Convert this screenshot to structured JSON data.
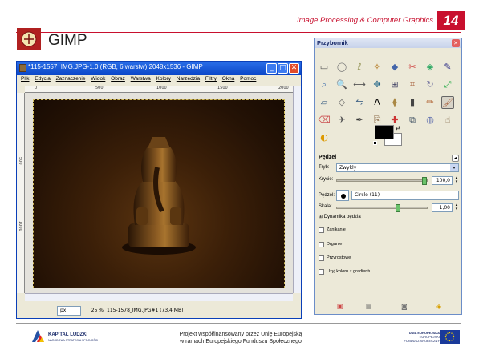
{
  "slide": {
    "header_title": "Image Processing & Computer Graphics",
    "page_number": "14",
    "heading": "GIMP"
  },
  "image_window": {
    "title": "*115-1557_IMG.JPG-1.0 (RGB, 6 warstw) 2048x1536 - GIMP",
    "menu": [
      "Plik",
      "Edycja",
      "Zaznaczenie",
      "Widok",
      "Obraz",
      "Warstwa",
      "Kolory",
      "Narzędzia",
      "Filtry",
      "Okna",
      "Pomoc"
    ],
    "ruler_h_ticks": [
      "0",
      "500",
      "1000",
      "1500",
      "2000"
    ],
    "ruler_v_ticks": [
      "500",
      "1000"
    ],
    "unit": "px",
    "zoom": "25 %",
    "status": "115-1578_IMG.JPG#1 (73,4 MB)"
  },
  "toolbox": {
    "title": "Przybornik",
    "options_title": "Pędzel",
    "mode_label": "Tryb:",
    "mode_value": "Zwykły",
    "opacity_label": "Krycie:",
    "opacity_value": "100,0",
    "brush_label": "Pędzel:",
    "brush_value": "Circle (11)",
    "scale_label": "Skala:",
    "scale_value": "1,00",
    "dynamics_label": "Dynamika pędzla",
    "checkboxes": [
      "Zanikanie",
      "Drganie",
      "Przyrostowe",
      "Użyj koloru z gradientu"
    ],
    "opacity_fraction": 1.0,
    "scale_fraction": 0.5,
    "colors": {
      "foreground": "#000000",
      "background": "#ffffff"
    },
    "tool_icons": [
      "rect-select-icon",
      "ellipse-select-icon",
      "lasso-icon",
      "fuzzy-select-icon",
      "color-select-icon",
      "scissors-icon",
      "foreground-select-icon",
      "paths-icon",
      "color-picker-icon",
      "zoom-icon",
      "measure-icon",
      "move-icon",
      "align-icon",
      "crop-icon",
      "rotate-icon",
      "scale-icon",
      "shear-icon",
      "perspective-icon",
      "flip-icon",
      "text-icon",
      "bucket-fill-icon",
      "blend-icon",
      "pencil-icon",
      "paintbrush-icon",
      "eraser-icon",
      "airbrush-icon",
      "ink-icon",
      "clone-icon",
      "heal-icon",
      "perspective-clone-icon",
      "convolve-icon",
      "smudge-icon",
      "dodge-burn-icon"
    ]
  },
  "footer": {
    "kl_title": "KAPITAŁ LUDZKI",
    "kl_sub": "NARODOWA STRATEGIA SPÓJNOŚCI",
    "project_line1": "Projekt współfinansowany przez Unię Europejską",
    "project_line2": "w ramach Europejskiego Funduszu Społecznego",
    "ue_line1": "UNIA EUROPEJSKA",
    "ue_line2": "EUROPEJSKI",
    "ue_line3": "FUNDUSZ SPOŁECZNY"
  },
  "accent_color": "#c8102e"
}
